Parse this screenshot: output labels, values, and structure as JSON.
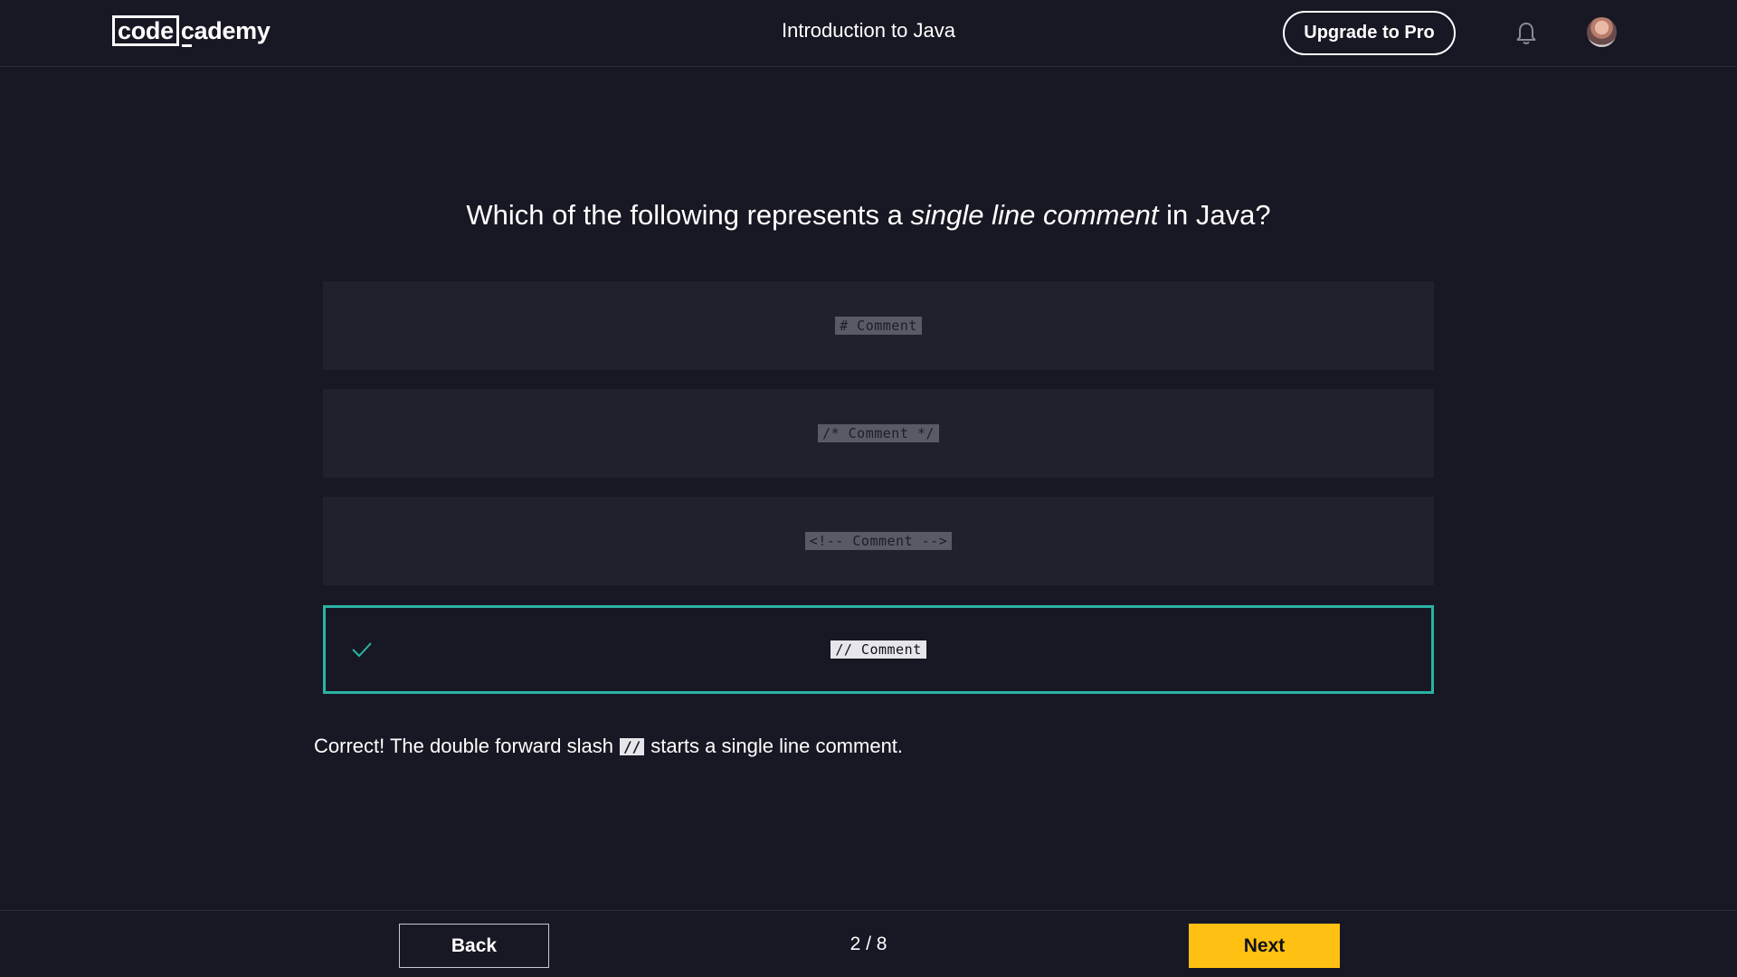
{
  "header": {
    "logo_box": "code",
    "logo_rest": "cademy",
    "title": "Introduction to Java",
    "upgrade_label": "Upgrade to Pro",
    "bell_icon": "bell-icon",
    "avatar": "user-avatar"
  },
  "quiz": {
    "question_pre": "Which of the following represents a ",
    "question_em": "single line comment",
    "question_post": " in Java?",
    "options": [
      {
        "code": "# Comment",
        "selected": false
      },
      {
        "code": "/* Comment */",
        "selected": false
      },
      {
        "code": "<!-- Comment -->",
        "selected": false
      },
      {
        "code": "// Comment",
        "selected": true
      }
    ],
    "feedback_pre": "Correct! The double forward slash",
    "feedback_code": "//",
    "feedback_post": "starts a single line comment."
  },
  "footer": {
    "back_label": "Back",
    "progress": "2 / 8",
    "next_label": "Next"
  },
  "colors": {
    "background": "#181824",
    "option_bg": "#21212d",
    "correct_border": "#2ab3a3",
    "next_button": "#ffc013"
  }
}
